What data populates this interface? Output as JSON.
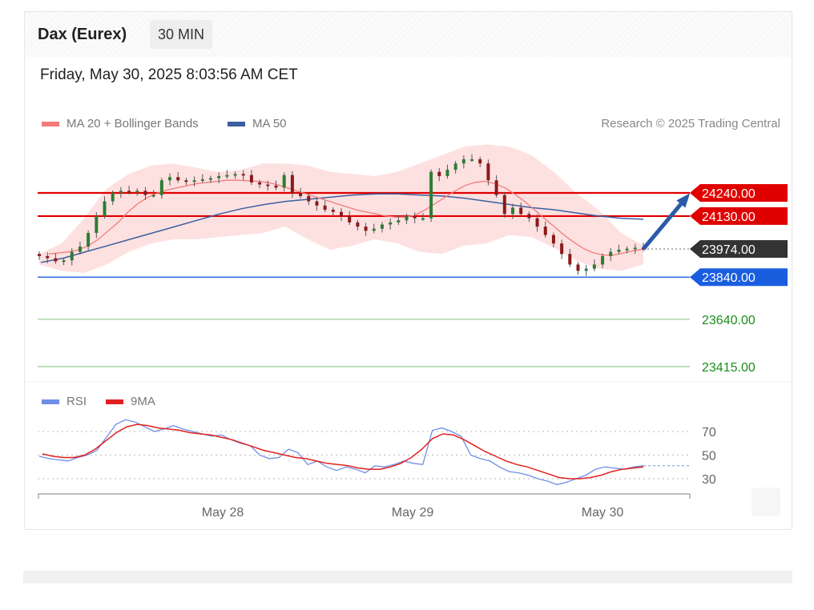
{
  "header": {
    "title": "Dax (Eurex)",
    "interval": "30 MIN",
    "datetime": "Friday, May 30, 2025 8:03:56 AM CET",
    "credit": "Research © 2025 Trading Central"
  },
  "legend": {
    "ma20_label": "MA 20 + Bollinger Bands",
    "ma50_label": "MA 50",
    "rsi_label": "RSI",
    "rsi_ma_label": "9MA"
  },
  "colors": {
    "ma20": "#f47a7a",
    "ma50": "#3b5fa0",
    "band_fill": "#fde1e1",
    "resistance": "#e00000",
    "pivot": "#1a5ee0",
    "support": "#1a8f1a",
    "support_line": "#a8d4a8",
    "last_price": "#333333",
    "rsi": "#6f8fe6",
    "rsi_ma": "#e02020",
    "arrow": "#2b5aa8"
  },
  "chart_data": [
    {
      "type": "candlestick",
      "title": "Dax (Eurex)",
      "interval": "30 MIN",
      "x_labels": [
        "May 28",
        "May 29",
        "May 30"
      ],
      "price_axis_range": [
        23400,
        24550
      ],
      "levels": [
        {
          "value": 24240.0,
          "label": "24240.00",
          "role": "resistance"
        },
        {
          "value": 24130.0,
          "label": "24130.00",
          "role": "resistance"
        },
        {
          "value": 23974.0,
          "label": "23974.00",
          "role": "last"
        },
        {
          "value": 23840.0,
          "label": "23840.00",
          "role": "pivot"
        },
        {
          "value": 23640.0,
          "label": "23640.00",
          "role": "support"
        },
        {
          "value": 23415.0,
          "label": "23415.00",
          "role": "support"
        }
      ],
      "close_path": [
        23940,
        23930,
        23915,
        23920,
        23960,
        23985,
        24050,
        24130,
        24200,
        24240,
        24250,
        24245,
        24250,
        24230,
        24230,
        24300,
        24315,
        24300,
        24295,
        24300,
        24305,
        24310,
        24320,
        24325,
        24330,
        24325,
        24290,
        24280,
        24275,
        24265,
        24325,
        24240,
        24225,
        24200,
        24180,
        24160,
        24150,
        24130,
        24100,
        24080,
        24060,
        24070,
        24090,
        24100,
        24110,
        24130,
        24120,
        24120,
        24340,
        24320,
        24350,
        24380,
        24400,
        24400,
        24380,
        24300,
        24230,
        24140,
        24170,
        24140,
        24120,
        24080,
        24040,
        24000,
        23950,
        23900,
        23870,
        23880,
        23900,
        23940,
        23960,
        23970,
        23975,
        23980,
        23974
      ],
      "ma20_path": [
        23950,
        23955,
        23960,
        23970,
        23990,
        24020,
        24060,
        24100,
        24150,
        24190,
        24220,
        24240,
        24255,
        24265,
        24275,
        24285,
        24290,
        24295,
        24300,
        24300,
        24298,
        24295,
        24290,
        24280,
        24265,
        24250,
        24235,
        24220,
        24205,
        24190,
        24175,
        24160,
        24150,
        24140,
        24130,
        24125,
        24125,
        24135,
        24160,
        24190,
        24220,
        24250,
        24275,
        24290,
        24295,
        24285,
        24265,
        24235,
        24200,
        24160,
        24120,
        24080,
        24040,
        24005,
        23975,
        23955,
        23945,
        23945,
        23955,
        23965,
        23974
      ],
      "ma50_path": [
        23910,
        23930,
        23960,
        23990,
        24020,
        24050,
        24080,
        24110,
        24140,
        24165,
        24185,
        24200,
        24210,
        24220,
        24230,
        24235,
        24235,
        24230,
        24225,
        24215,
        24200,
        24185,
        24170,
        24160,
        24145,
        24130,
        24120,
        24115
      ],
      "bollinger_upper_path": [
        23950,
        24000,
        24120,
        24260,
        24330,
        24370,
        24380,
        24360,
        24340,
        24350,
        24380,
        24380,
        24370,
        24340,
        24330,
        24320,
        24340,
        24380,
        24420,
        24460,
        24470,
        24460,
        24420,
        24340,
        24240,
        24160,
        24050,
        23990
      ],
      "bollinger_lower_path": [
        23900,
        23870,
        23860,
        23900,
        23960,
        24000,
        24020,
        24020,
        24030,
        24040,
        24050,
        24080,
        24020,
        23970,
        23990,
        24020,
        24000,
        23960,
        23950,
        23990,
        24000,
        24040,
        24030,
        23980,
        23920,
        23880,
        23870,
        23900
      ]
    },
    {
      "type": "line",
      "title": "RSI",
      "series": [
        {
          "name": "RSI",
          "values": [
            49,
            47,
            46,
            45,
            48,
            50,
            54,
            65,
            76,
            80,
            78,
            74,
            70,
            72,
            75,
            72,
            70,
            68,
            66,
            67,
            63,
            60,
            58,
            50,
            47,
            48,
            55,
            52,
            42,
            45,
            40,
            37,
            40,
            38,
            35,
            41,
            40,
            42,
            45,
            43,
            42,
            71,
            73,
            70,
            66,
            50,
            47,
            45,
            40,
            36,
            35,
            33,
            30,
            28,
            25,
            27,
            30,
            33,
            38,
            40,
            39,
            38,
            40,
            41
          ]
        },
        {
          "name": "9MA",
          "values": [
            51,
            49,
            48,
            48,
            50,
            55,
            62,
            69,
            74,
            76,
            75,
            73,
            72,
            71,
            69,
            68,
            67,
            65,
            63,
            60,
            57,
            54,
            52,
            50,
            48,
            47,
            45,
            43,
            42,
            41,
            39,
            38,
            38,
            40,
            43,
            48,
            55,
            64,
            68,
            67,
            63,
            58,
            53,
            49,
            45,
            42,
            40,
            37,
            34,
            31,
            30,
            30,
            31,
            33,
            36,
            38,
            39,
            40
          ]
        }
      ],
      "y_ticks": [
        70,
        50,
        30
      ],
      "ylim": [
        15,
        90
      ]
    }
  ]
}
